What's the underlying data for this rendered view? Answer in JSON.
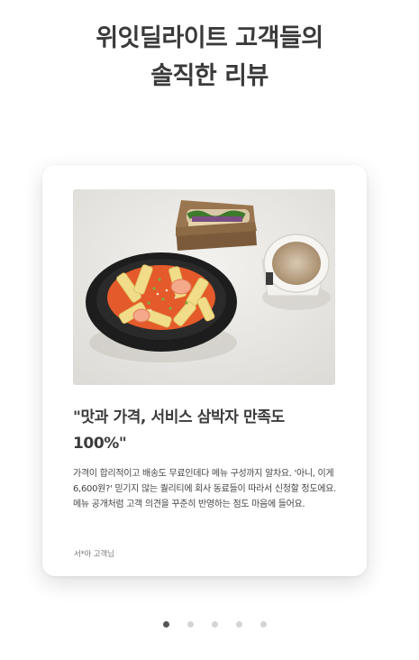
{
  "heading": {
    "line1": "위잇딜라이트 고객들의",
    "line2": "솔직한 리뷰"
  },
  "review": {
    "title": "\"맛과 가격, 서비스 삼박자 만족도\n100%\"",
    "body": "가격이 합리적이고 배송도 무료인데다 메뉴 구성까지 알차요. '아니, 이게 6,600원?' 믿기지 않는 퀄리티에 회사 동료들이 따라서 신청할 정도에요. 메뉴 공개처럼 고객 의견을 꾸준히 반영하는 점도 마음에 들어요.",
    "reviewer": "서*아 고객님",
    "photo_icon": "food-photo"
  },
  "carousel": {
    "slide_count": 5,
    "active_index": 0
  },
  "colors": {
    "heading": "#3a3a3a",
    "dot_active": "#555555",
    "dot_inactive": "#d4d4d4"
  }
}
